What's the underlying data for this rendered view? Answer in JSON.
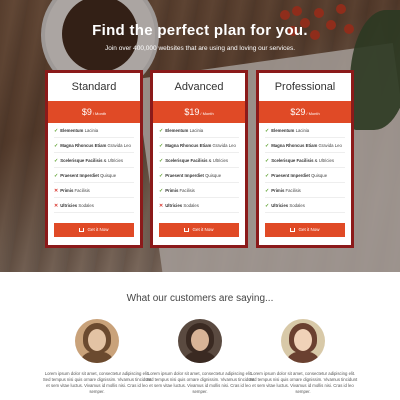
{
  "hero": {
    "title": "Find the perfect plan for you.",
    "subtitle": "Join over 400,000 websites that are using and loving our services."
  },
  "plans": [
    {
      "name": "Standard",
      "price": "$9",
      "period": "/ Month",
      "features": [
        {
          "bold": "Elementum",
          "rest": " Lacinia",
          "included": true
        },
        {
          "bold": "Magna Rhoncus Etiam",
          "rest": " Gravida Leo",
          "included": true
        },
        {
          "bold": "Scelerisque Facilisis",
          "rest": " & Ultricies",
          "included": true
        },
        {
          "bold": "Praesent Imperdiet",
          "rest": " Quisque",
          "included": true
        },
        {
          "bold": "Primis",
          "rest": " Facilisis",
          "included": false
        },
        {
          "bold": "Ultricies",
          "rest": " Sodales",
          "included": false
        }
      ],
      "button": "Get it Now"
    },
    {
      "name": "Advanced",
      "price": "$19",
      "period": "/ Month",
      "features": [
        {
          "bold": "Elementum",
          "rest": " Lacinia",
          "included": true
        },
        {
          "bold": "Magna Rhoncus Etiam",
          "rest": " Gravida Leo",
          "included": true
        },
        {
          "bold": "Scelerisque Facilisis",
          "rest": " & Ultricies",
          "included": true
        },
        {
          "bold": "Praesent Imperdiet",
          "rest": " Quisque",
          "included": true
        },
        {
          "bold": "Primis",
          "rest": " Facilisis",
          "included": true
        },
        {
          "bold": "Ultricies",
          "rest": " Sodales",
          "included": false
        }
      ],
      "button": "Get it Now"
    },
    {
      "name": "Professional",
      "price": "$29",
      "period": "/ Month",
      "features": [
        {
          "bold": "Elementum",
          "rest": " Lacinia",
          "included": true
        },
        {
          "bold": "Magna Rhoncus Etiam",
          "rest": " Gravida Leo",
          "included": true
        },
        {
          "bold": "Scelerisque Facilisis",
          "rest": " & Ultricies",
          "included": true
        },
        {
          "bold": "Praesent Imperdiet",
          "rest": " Quisque",
          "included": true
        },
        {
          "bold": "Primis",
          "rest": " Facilisis",
          "included": true
        },
        {
          "bold": "Ultricies",
          "rest": " Sodales",
          "included": true
        }
      ],
      "button": "Get it Now"
    }
  ],
  "testimonials": {
    "title": "What our customers are saying...",
    "items": [
      {
        "quote": "Lorem ipsum dolor sit amet, consectetur adipiscing elit. Sed tempus nisi quis ornare dignissim. Vivamus tincidunt et sem vitae luctus. Vivamus id mollis nisi. Cras id leo semper.",
        "avatar_colors": [
          "#c9a27a",
          "#6b4a2f",
          "#e3c3a4"
        ]
      },
      {
        "quote": "Lorem ipsum dolor sit amet, consectetur adipiscing elit. Sed tempus nisi quis ornare dignissim. Vivamus tincidunt et sem vitae luctus. Vivamus id mollis nisi. Cras id leo semper.",
        "avatar_colors": [
          "#5a4a40",
          "#3a2a22",
          "#d8b497"
        ]
      },
      {
        "quote": "Lorem ipsum dolor sit amet, consectetur adipiscing elit. Sed tempus nisi quis ornare dignissim. Vivamus tincidunt et sem vitae luctus. Vivamus id mollis nisi. Cras id leo semper.",
        "avatar_colors": [
          "#d8c9a8",
          "#6a4030",
          "#f0d2b8"
        ]
      }
    ]
  },
  "colors": {
    "accent": "#e04a26",
    "frame": "#8b1a1a",
    "check": "#5aa02c",
    "cross": "#d9332b"
  },
  "icons": {
    "included": "check-icon",
    "excluded": "cross-icon",
    "button": "cart-icon"
  }
}
